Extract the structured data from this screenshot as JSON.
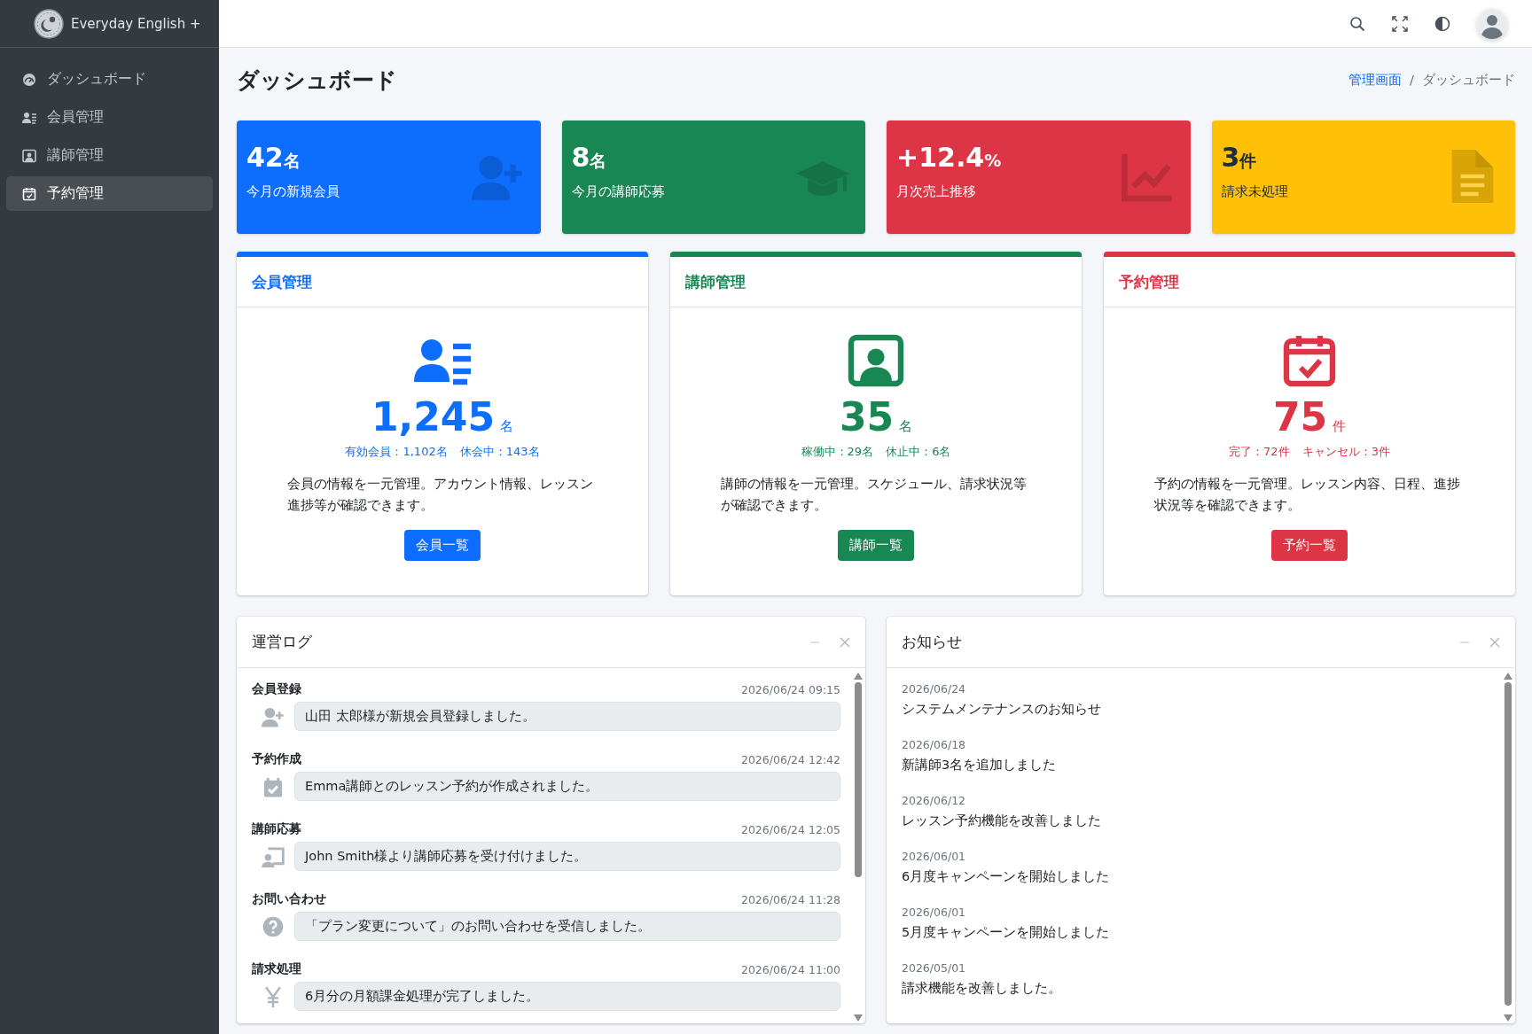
{
  "brand": {
    "name": "Everyday English +"
  },
  "sidebar": {
    "items": [
      {
        "label": "ダッシュボード",
        "selected": false
      },
      {
        "label": "会員管理",
        "selected": false
      },
      {
        "label": "講師管理",
        "selected": false
      },
      {
        "label": "予約管理",
        "selected": true
      }
    ]
  },
  "page_title": "ダッシュボード",
  "breadcrumb": [
    {
      "label": "管理画面"
    },
    {
      "label": "/"
    },
    {
      "label": "ダッシュボード"
    }
  ],
  "stats": [
    {
      "value": "42",
      "unit": "名",
      "label": "今月の新規会員",
      "color": "#0d6efd"
    },
    {
      "value": "8",
      "unit": "名",
      "label": "今月の講師応募",
      "color": "#198754"
    },
    {
      "value": "+12.4",
      "unit": "%",
      "label": "月次売上推移",
      "color": "#dc3545"
    },
    {
      "value": "3",
      "unit": "件",
      "label": "請求未処理",
      "color": "#ffc107"
    }
  ],
  "modules": [
    {
      "title": "会員管理",
      "color": "#0d6efd",
      "count": "1,245",
      "unit": "名",
      "details": [
        "有効会員：1,102名",
        "休会中：143名"
      ],
      "description": "会員の情報を一元管理。アカウント情報、レッスン進捗等が確認できます。",
      "button": "会員一覧"
    },
    {
      "title": "講師管理",
      "color": "#198754",
      "count": "35",
      "unit": "名",
      "details": [
        "稼働中：29名",
        "休止中：6名"
      ],
      "description": "講師の情報を一元管理。スケジュール、請求状況等が確認できます。",
      "button": "講師一覧"
    },
    {
      "title": "予約管理",
      "color": "#dc3545",
      "count": "75",
      "unit": "件",
      "details": [
        "完了：72件",
        "キャンセル：3件"
      ],
      "description": "予約の情報を一元管理。レッスン内容、日程、進捗状況等を確認できます。",
      "button": "予約一覧"
    }
  ],
  "log_panel": {
    "title": "運営ログ",
    "entries": [
      {
        "category": "会員登録",
        "time": "2026/06/24 09:15",
        "message": "山田 太郎様が新規会員登録しました。"
      },
      {
        "category": "予約作成",
        "time": "2026/06/24 12:42",
        "message": "Emma講師とのレッスン予約が作成されました。"
      },
      {
        "category": "講師応募",
        "time": "2026/06/24 12:05",
        "message": "John Smith様より講師応募を受け付けました。"
      },
      {
        "category": "お問い合わせ",
        "time": "2026/06/24 11:28",
        "message": "「プラン変更について」のお問い合わせを受信しました。"
      },
      {
        "category": "請求処理",
        "time": "2026/06/24 11:00",
        "message": "6月分の月額課金処理が完了しました。"
      }
    ]
  },
  "notice_panel": {
    "title": "お知らせ",
    "items": [
      {
        "date": "2026/06/24",
        "title": "システムメンテナンスのお知らせ"
      },
      {
        "date": "2026/06/18",
        "title": "新講師3名を追加しました"
      },
      {
        "date": "2026/06/12",
        "title": "レッスン予約機能を改善しました"
      },
      {
        "date": "2026/06/01",
        "title": "6月度キャンペーンを開始しました"
      },
      {
        "date": "2026/06/01",
        "title": "5月度キャンペーンを開始しました"
      },
      {
        "date": "2026/05/01",
        "title": "請求機能を改善しました。"
      }
    ]
  }
}
